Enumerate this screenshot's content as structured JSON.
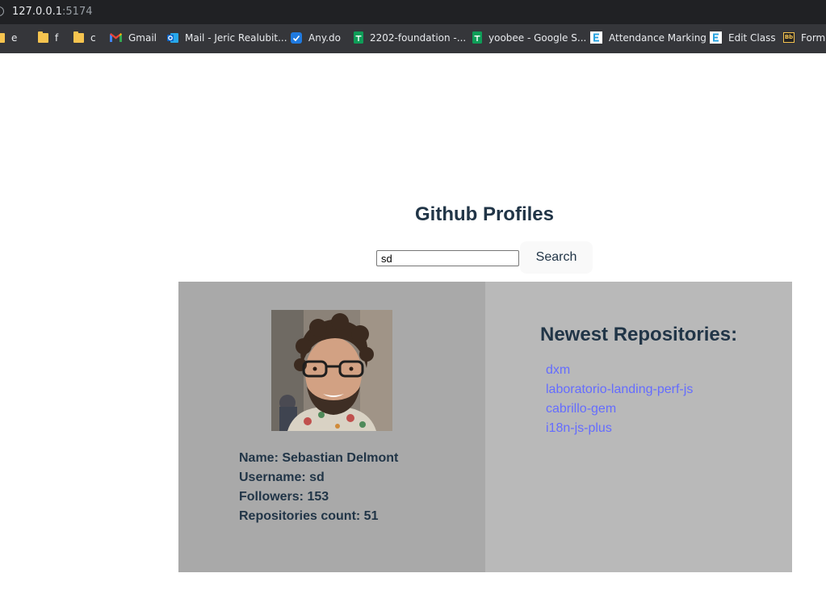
{
  "browser": {
    "url_host": "127.0.0.1",
    "url_port": ":5174",
    "bookmarks": [
      {
        "label": "e",
        "icon": "folder-icon"
      },
      {
        "label": "f",
        "icon": "folder-icon"
      },
      {
        "label": "c",
        "icon": "folder-icon"
      },
      {
        "label": "Gmail",
        "icon": "gmail-icon"
      },
      {
        "label": "Mail - Jeric Realubit...",
        "icon": "outlook-icon"
      },
      {
        "label": "Any.do",
        "icon": "anydo-icon"
      },
      {
        "label": "2202-foundation -...",
        "icon": "google-sheets-icon"
      },
      {
        "label": "yoobee - Google S...",
        "icon": "google-sheets-icon"
      },
      {
        "label": "Attendance Marking",
        "icon": "edclass-icon"
      },
      {
        "label": "Edit Class",
        "icon": "edclass-icon"
      },
      {
        "label": "Forma",
        "icon": "blackboard-icon"
      }
    ]
  },
  "page": {
    "title": "Github Profiles",
    "search": {
      "value": "sd",
      "placeholder": ""
    },
    "search_button": "Search"
  },
  "profile": {
    "name": "Name: Sebastian Delmont",
    "username": "Username: sd",
    "followers": "Followers: 153",
    "repos_count": "Repositories count: 51"
  },
  "repos": {
    "heading": "Newest Repositories:",
    "items": [
      "dxm",
      "laboratorio-landing-perf-js",
      "cabrillo-gem",
      "i18n-js-plus"
    ]
  },
  "colors": {
    "heading_text": "#213547",
    "link": "#646cff",
    "profile_card_bg": "#a9a9a9",
    "repos_card_bg": "#b9b9b9",
    "button_bg": "#f9f9f9"
  }
}
